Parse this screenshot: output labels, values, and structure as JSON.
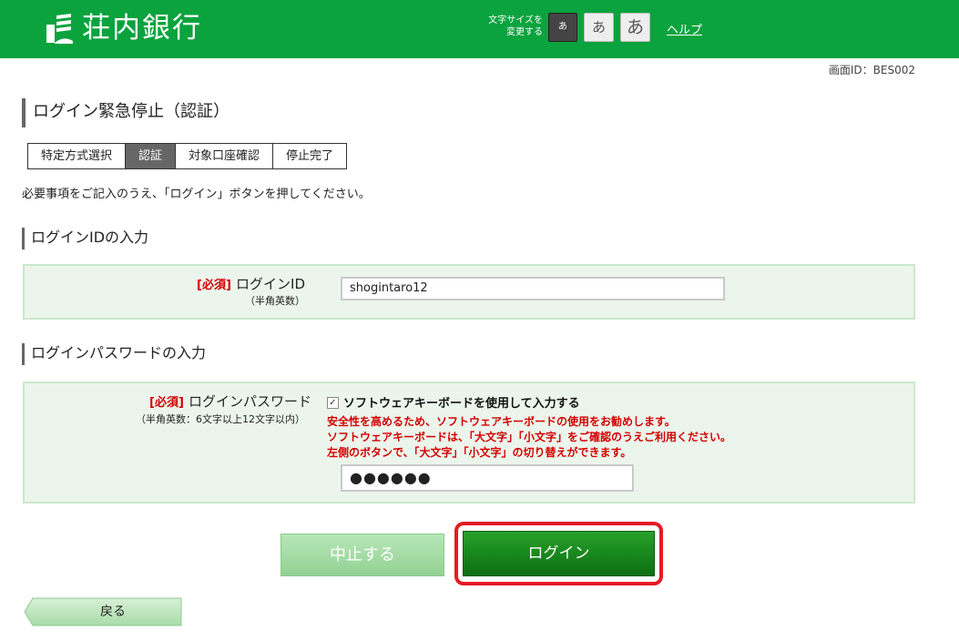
{
  "header": {
    "logo_text": "荘内銀行",
    "font_size_label_line1": "文字サイズを",
    "font_size_label_line2": "変更する",
    "font_small": "あ",
    "font_medium": "あ",
    "font_large": "あ",
    "help": "ヘルプ",
    "brand_color": "#0aa33e"
  },
  "screen_id": "画面ID：BES002",
  "page_title": "ログイン緊急停止（認証）",
  "steps": [
    {
      "label": "特定方式選択",
      "active": false
    },
    {
      "label": "認証",
      "active": true
    },
    {
      "label": "対象口座確認",
      "active": false
    },
    {
      "label": "停止完了",
      "active": false
    }
  ],
  "instruction": "必要事項をご記入のうえ、「ログイン」ボタンを押してください。",
  "login_id_section": {
    "title": "ログインIDの入力",
    "required": "[必須]",
    "label": "ログインID",
    "note": "（半角英数）",
    "value": "shogintaro12"
  },
  "password_section": {
    "title": "ログインパスワードの入力",
    "required": "[必須]",
    "label": "ログインパスワード",
    "note": "（半角英数：6文字以上12文字以内）",
    "checkbox_checked": true,
    "checkbox_label": "ソフトウェアキーボードを使用して入力する",
    "warning_1": "安全性を高めるため、ソフトウェアキーボードの使用をお勧めします。",
    "warning_2": "ソフトウェアキーボードは、「大文字」「小文字」をご確認のうえご利用ください。",
    "warning_3": "左側のボタンで、「大文字」「小文字」の切り替えができます。",
    "value": "●●●●●●"
  },
  "buttons": {
    "cancel": "中止する",
    "login": "ログイン",
    "back": "戻る"
  }
}
